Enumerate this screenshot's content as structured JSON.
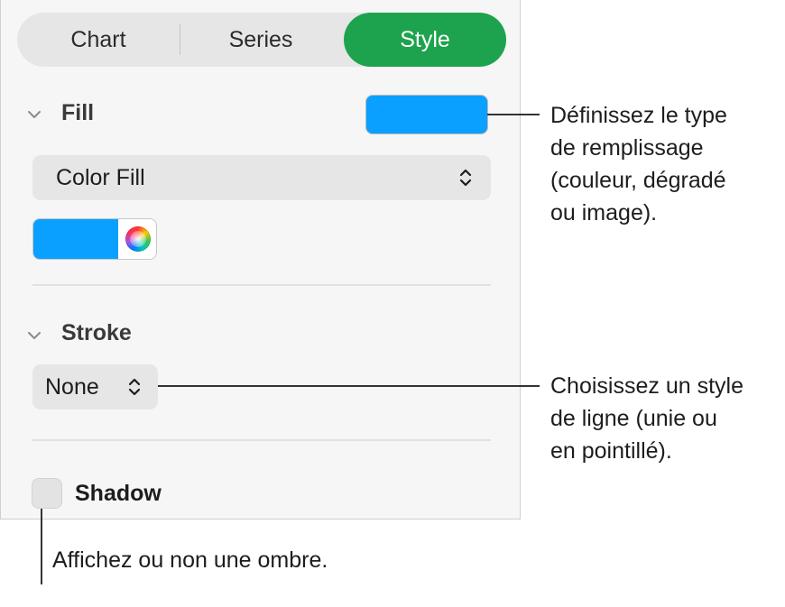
{
  "tabs": [
    {
      "label": "Chart",
      "selected": false
    },
    {
      "label": "Series",
      "selected": false
    },
    {
      "label": "Style",
      "selected": true
    }
  ],
  "colors": {
    "accent": "#1da34d",
    "fill_color": "#0aa0ff"
  },
  "fill": {
    "title": "Fill",
    "type_popup": {
      "value": "Color Fill"
    }
  },
  "stroke": {
    "title": "Stroke",
    "style_popup": {
      "value": "None"
    }
  },
  "shadow": {
    "label": "Shadow",
    "checked": false
  },
  "callouts": {
    "fill": "Définissez le type\nde remplissage\n(couleur, dégradé\nou image).",
    "stroke": "Choisissez un style\nde ligne (unie ou\nen pointillé).",
    "shadow": "Affichez ou non une ombre."
  }
}
